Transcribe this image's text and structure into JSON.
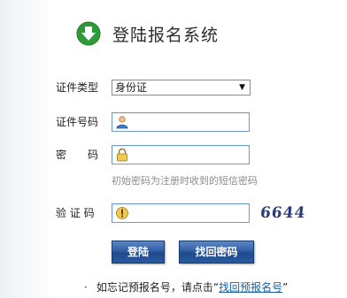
{
  "header": {
    "title": "登陆报名系统",
    "logo_icon": "down-arrow-circle-icon"
  },
  "form": {
    "id_type": {
      "label": "证件类型",
      "value": "身份证"
    },
    "id_number": {
      "label": "证件号码",
      "value": "",
      "icon": "user-icon"
    },
    "password": {
      "label": "密　　码",
      "value": "",
      "icon": "lock-icon",
      "hint": "初始密码为注册时收到的短信密码"
    },
    "captcha": {
      "label": "验 证 码",
      "value": "",
      "icon": "key-icon",
      "image_text": "6644"
    }
  },
  "buttons": {
    "login": "登陆",
    "find_password": "找回密码"
  },
  "footer": {
    "bullet": "·",
    "text": "如忘记预报名号，请点击",
    "open_quote": "“",
    "link": "找回预报名号",
    "close_quote": "”"
  },
  "colors": {
    "accent": "#1f4a8c",
    "logo_green": "#2f9a3a",
    "border": "#6f9bc9"
  }
}
